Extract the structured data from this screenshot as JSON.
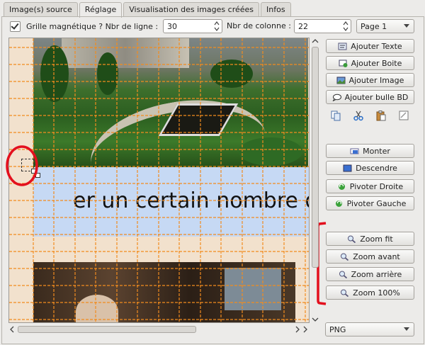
{
  "tabs": [
    "Image(s) source",
    "Réglage",
    "Visualisation des images créées",
    "Infos"
  ],
  "active_tab": "Réglage",
  "toolbar": {
    "grid_checked": true,
    "grid_label": "Grille magnétique ? Nbr de ligne :",
    "rows_value": "30",
    "cols_label": "Nbr de colonne :",
    "cols_value": "22",
    "page_value": "Page 1"
  },
  "canvas": {
    "sample_text": "er un certain nombre d"
  },
  "buttons": {
    "add_text": "Ajouter Texte",
    "add_box": "Ajouter Boite",
    "add_image": "Ajouter Image",
    "add_bubble": "Ajouter bulle BD",
    "raise": "Monter",
    "lower": "Descendre",
    "rotate_right": "Pivoter Droite",
    "rotate_left": "Pivoter Gauche",
    "zoom_fit": "Zoom fit",
    "zoom_in": "Zoom avant",
    "zoom_out": "Zoom arrière",
    "zoom_100": "Zoom 100%"
  },
  "format_value": "PNG",
  "colors": {
    "grid": "#f28c1e",
    "annotation": "#e3101e",
    "text_band": "#c6d9f4",
    "page_bg": "#f2e1cd"
  }
}
